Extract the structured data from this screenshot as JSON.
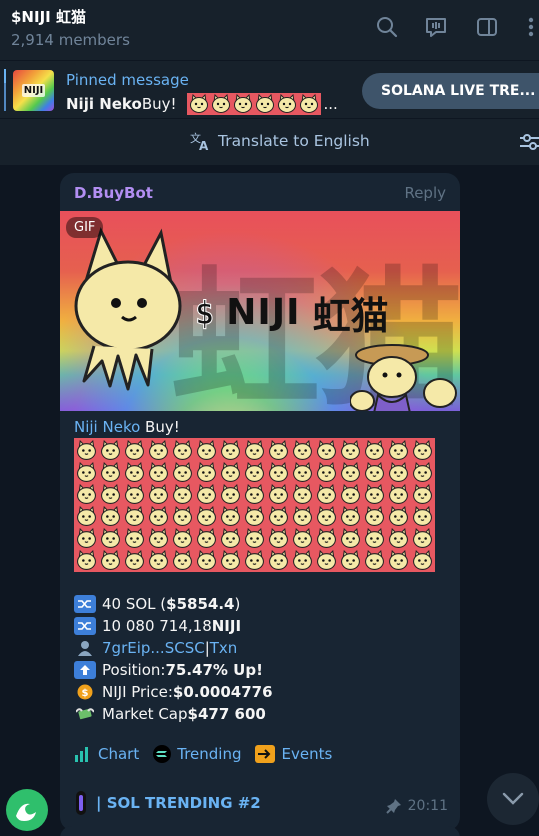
{
  "header": {
    "title": "$NIJI 虹猫",
    "members": "2,914 members",
    "icons": [
      "search-icon",
      "live-chat-icon",
      "sidebar-toggle-icon",
      "more-icon"
    ]
  },
  "pinned": {
    "label": "Pinned message",
    "text_bold": "Niji Neko",
    "text_rest": " Buy!",
    "ellipsis": "...",
    "thumb_text": "NIJI",
    "button_label": "SOLANA LIVE TRE..."
  },
  "translate": {
    "label": "Translate to English"
  },
  "message": {
    "sender": "D.BuyBot",
    "reply": "Reply",
    "gif_badge": "GIF",
    "gif_dollar": "$",
    "gif_name": "NIJI",
    "gif_kanji": "虹猫",
    "gif_bg_kanji": "虹猫",
    "title_link": "Niji Neko",
    "title_rest": " Buy!",
    "lines": {
      "l1_pre": "40 SOL (",
      "l1_bold": "$5854.4",
      "l1_post": ")",
      "l2_pre": "10 080 714,18 ",
      "l2_bold": "NIJI",
      "l3_link1": "7grEip...SCSC",
      "l3_sep": " | ",
      "l3_link2": "Txn",
      "l4_pre": "Position: ",
      "l4_bold": "75.47% Up!",
      "l5_pre": "NIJI Price: ",
      "l5_bold": "$0.0004776",
      "l6_pre": "Market Cap ",
      "l6_bold": "$477 600"
    },
    "actions": {
      "chart": "Chart",
      "trending": "Trending",
      "events": "Events"
    },
    "trending_line": "| SOL TRENDING #2",
    "time": "20:11"
  },
  "colors": {
    "bg": "#0e1621",
    "panel": "#17212b",
    "bubble": "#182533",
    "accent": "#6ab3f3",
    "sender": "#b28ef2",
    "cat_bg": "#e75861"
  }
}
